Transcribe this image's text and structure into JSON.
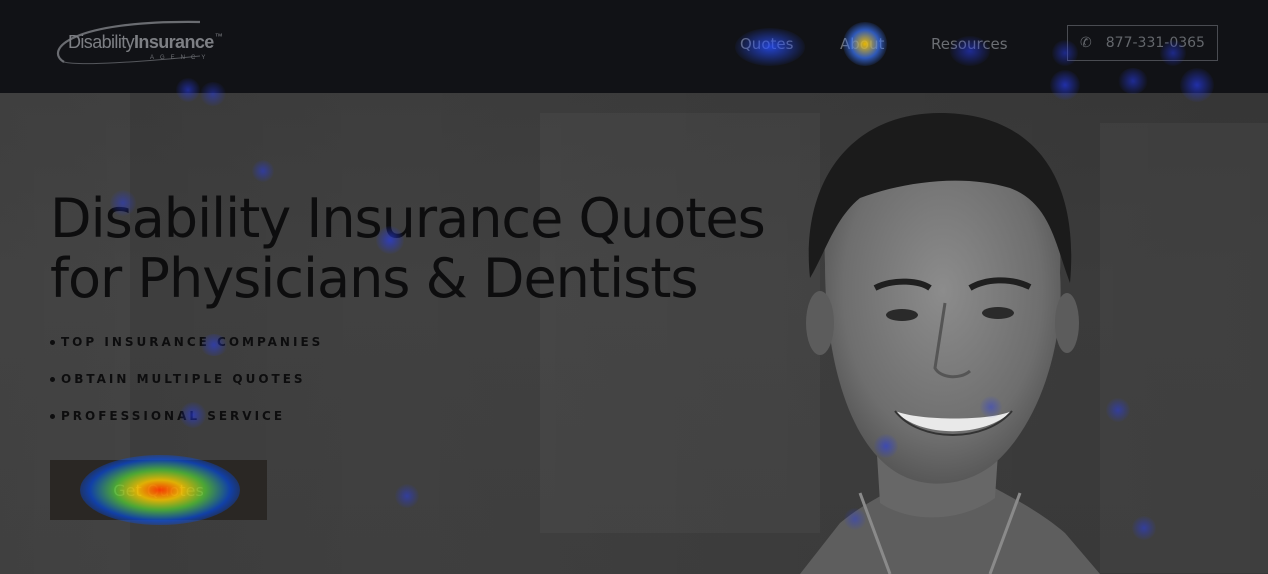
{
  "header": {
    "logo": {
      "name_regular": "Disability",
      "name_bold": "Insurance",
      "trademark": "™",
      "subtitle": "AGENCY"
    },
    "nav": [
      {
        "label": "Quotes"
      },
      {
        "label": "About"
      },
      {
        "label": "Resources"
      }
    ],
    "phone": {
      "number": "877-331-0365",
      "icon": "phone-icon"
    }
  },
  "hero": {
    "headline_line1": "Disability Insurance Quotes",
    "headline_line2": "for Physicians & Dentists",
    "bullets": [
      {
        "label": "TOP INSURANCE COMPANIES"
      },
      {
        "label": "OBTAIN MULTIPLE QUOTES"
      },
      {
        "label": "PROFESSIONAL SERVICE"
      }
    ],
    "cta_label": "Get Quotes"
  },
  "colors": {
    "header_bg": "#111216",
    "hero_bg": "#3f3f3f",
    "headline_text": "#0d0d0e",
    "nav_text": "#6b6e73",
    "cta_bg": "#2a2724"
  }
}
